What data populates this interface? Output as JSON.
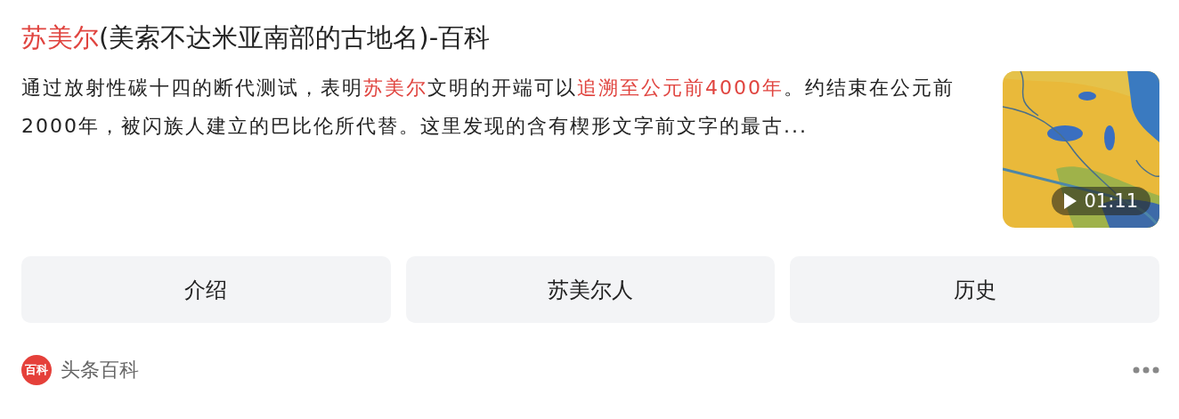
{
  "title": {
    "segments": [
      {
        "text": "苏美尔",
        "highlight": true
      },
      {
        "text": "(美索不达米亚南部的古地名)-百科",
        "highlight": false
      }
    ]
  },
  "snippet": {
    "segments": [
      {
        "text": "通过放射性碳十四的断代测试，表明",
        "highlight": false
      },
      {
        "text": "苏美尔",
        "highlight": true
      },
      {
        "text": "文明的开端可以",
        "highlight": false
      },
      {
        "text": "追溯至公元前4000年",
        "highlight": true
      },
      {
        "text": "。约结束在公元前2000年，被闪族人建立的巴比伦所代替。这里发现的含有楔形文字前文字的最古...",
        "highlight": false
      }
    ]
  },
  "video": {
    "kind": "picture",
    "duration": "01:11"
  },
  "tabs": [
    "介绍",
    "苏美尔人",
    "历史"
  ],
  "source": {
    "logo": "百科",
    "name": "头条百科"
  }
}
